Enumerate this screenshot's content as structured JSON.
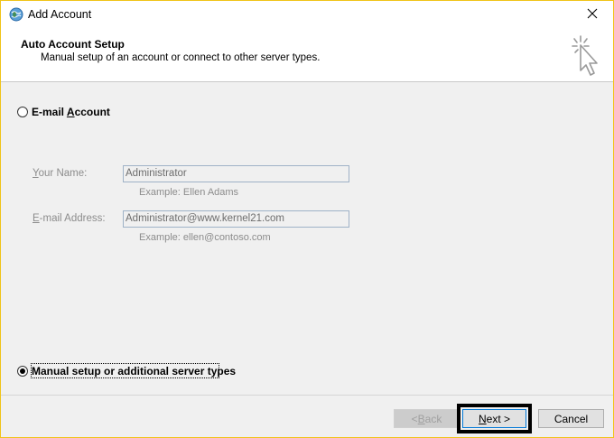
{
  "window": {
    "title": "Add Account",
    "border_color": "#f0c419"
  },
  "header": {
    "title": "Auto Account Setup",
    "subtitle": "Manual setup of an account or connect to other server types."
  },
  "options": {
    "email_account": {
      "label_prefix": "E-mail ",
      "label_hotkey": "A",
      "label_rest": "ccount",
      "selected": false
    },
    "manual_setup": {
      "label": "Manual setup or additional server types",
      "selected": true
    }
  },
  "fields": {
    "your_name": {
      "label_hotkey": "Y",
      "label_rest": "our Name:",
      "value": "Administrator",
      "example": "Example: Ellen Adams",
      "enabled": false
    },
    "email_address": {
      "label_hotkey": "E",
      "label_rest": "-mail Address:",
      "value": "Administrator@www.kernel21.com",
      "example": "Example: ellen@contoso.com",
      "enabled": false
    }
  },
  "buttons": {
    "back": {
      "prefix": "< ",
      "hotkey": "B",
      "rest": "ack",
      "enabled": false
    },
    "next": {
      "hotkey": "N",
      "rest": "ext >",
      "enabled": true,
      "highlighted": true
    },
    "cancel": {
      "label": "Cancel",
      "enabled": true
    }
  },
  "icons": {
    "app": "outlook-globe-icon",
    "close": "close-icon",
    "wizard": "cursor-sparkle-icon"
  }
}
